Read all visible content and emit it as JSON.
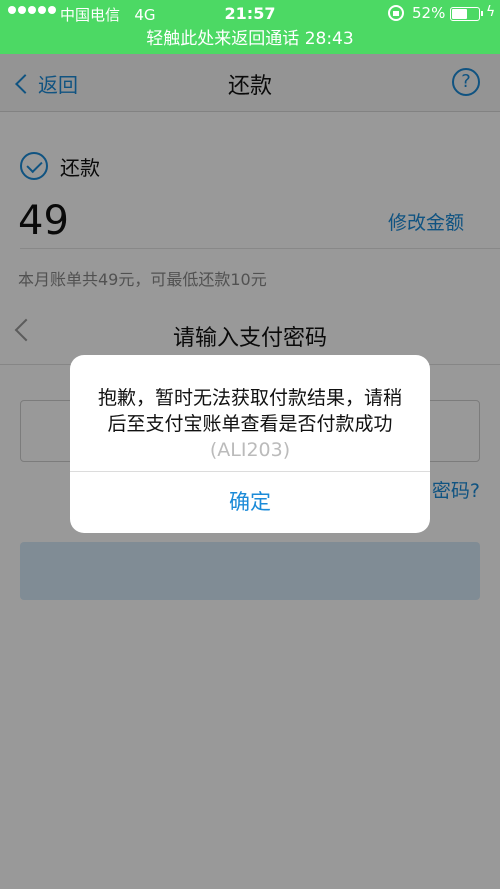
{
  "status_bar": {
    "carrier": "中国电信",
    "network": "4G",
    "time": "21:57",
    "battery_percent": "52%",
    "battery_level": 0.52
  },
  "call_banner": {
    "text": "轻触此处来返回通话 28:43"
  },
  "nav": {
    "back_label": "返回",
    "title": "还款",
    "help_icon": "?"
  },
  "repay": {
    "label": "还款",
    "amount": "49",
    "modify_label": "修改金额",
    "note": "本月账单共49元，可最低还款10元"
  },
  "password_sheet": {
    "title": "请输入支付密码",
    "forgot_label": "密码?"
  },
  "alert": {
    "message": "抱歉，暂时无法获取付款结果，请稍后至支付宝账单查看是否付款成功",
    "code": "(ALI203)",
    "confirm_label": "确定"
  },
  "colors": {
    "accent": "#1b8bd8",
    "status_green": "#4cd964"
  }
}
